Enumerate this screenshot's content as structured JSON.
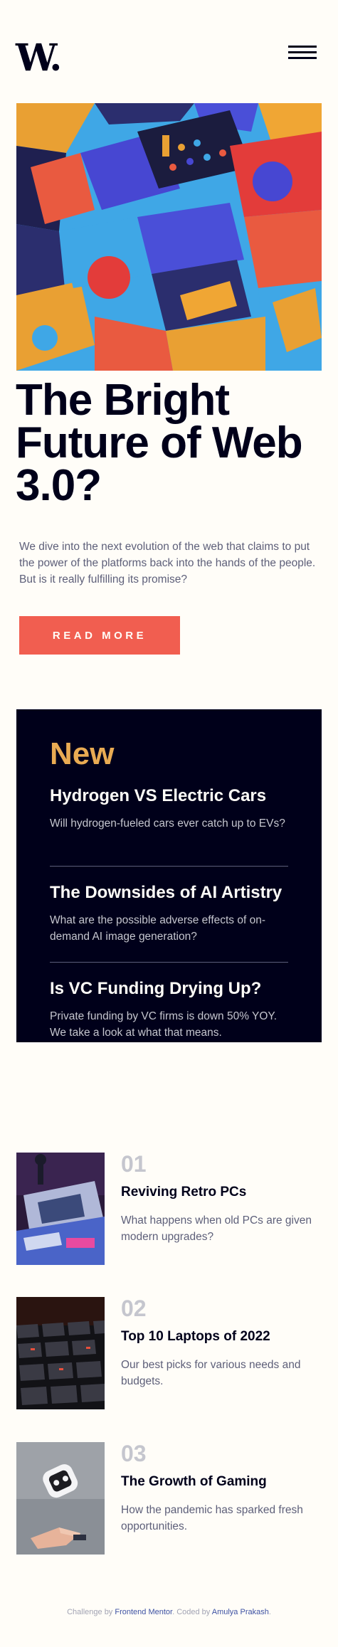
{
  "header": {
    "logo_text": "W.",
    "menu_icon": "hamburger-menu-icon"
  },
  "hero": {
    "image_alt": "Colorful abstract 3D blocks",
    "title": "The Bright Future of Web 3.0?",
    "description": "We dive into the next evolution of the web that claims to put the power of the platforms back into the hands of the people. But is it really fulfilling its promise?",
    "button_label": "READ MORE"
  },
  "new": {
    "heading": "New",
    "items": [
      {
        "title": "Hydrogen VS Electric Cars",
        "description": "Will hydrogen-fueled cars ever catch up to EVs?"
      },
      {
        "title": "The Downsides of AI Artistry",
        "description": "What are the possible adverse effects of on-demand AI image generation?"
      },
      {
        "title": "Is VC Funding Drying Up?",
        "description": "Private funding by VC firms is down 50% YOY. We take a look at what that means."
      }
    ]
  },
  "articles": [
    {
      "number": "01",
      "title": "Reviving Retro PCs",
      "description": "What happens when old PCs are given modern upgrades?"
    },
    {
      "number": "02",
      "title": "Top 10 Laptops of 2022",
      "description": "Our best picks for various needs and budgets."
    },
    {
      "number": "03",
      "title": "The Growth of Gaming",
      "description": "How the pandemic has sparked fresh opportunities."
    }
  ],
  "footer": {
    "prefix": "Challenge by ",
    "challenge_link": "Frontend Mentor",
    "middle": ". Coded by ",
    "author_link": "Amulya Prakash",
    "suffix": "."
  },
  "colors": {
    "background": "#fffdf8",
    "dark": "#00001a",
    "accent_red": "#f15e50",
    "accent_orange": "#e9ab53",
    "grey_blue": "#5d5f79",
    "grey_light": "#c5c6ce"
  }
}
